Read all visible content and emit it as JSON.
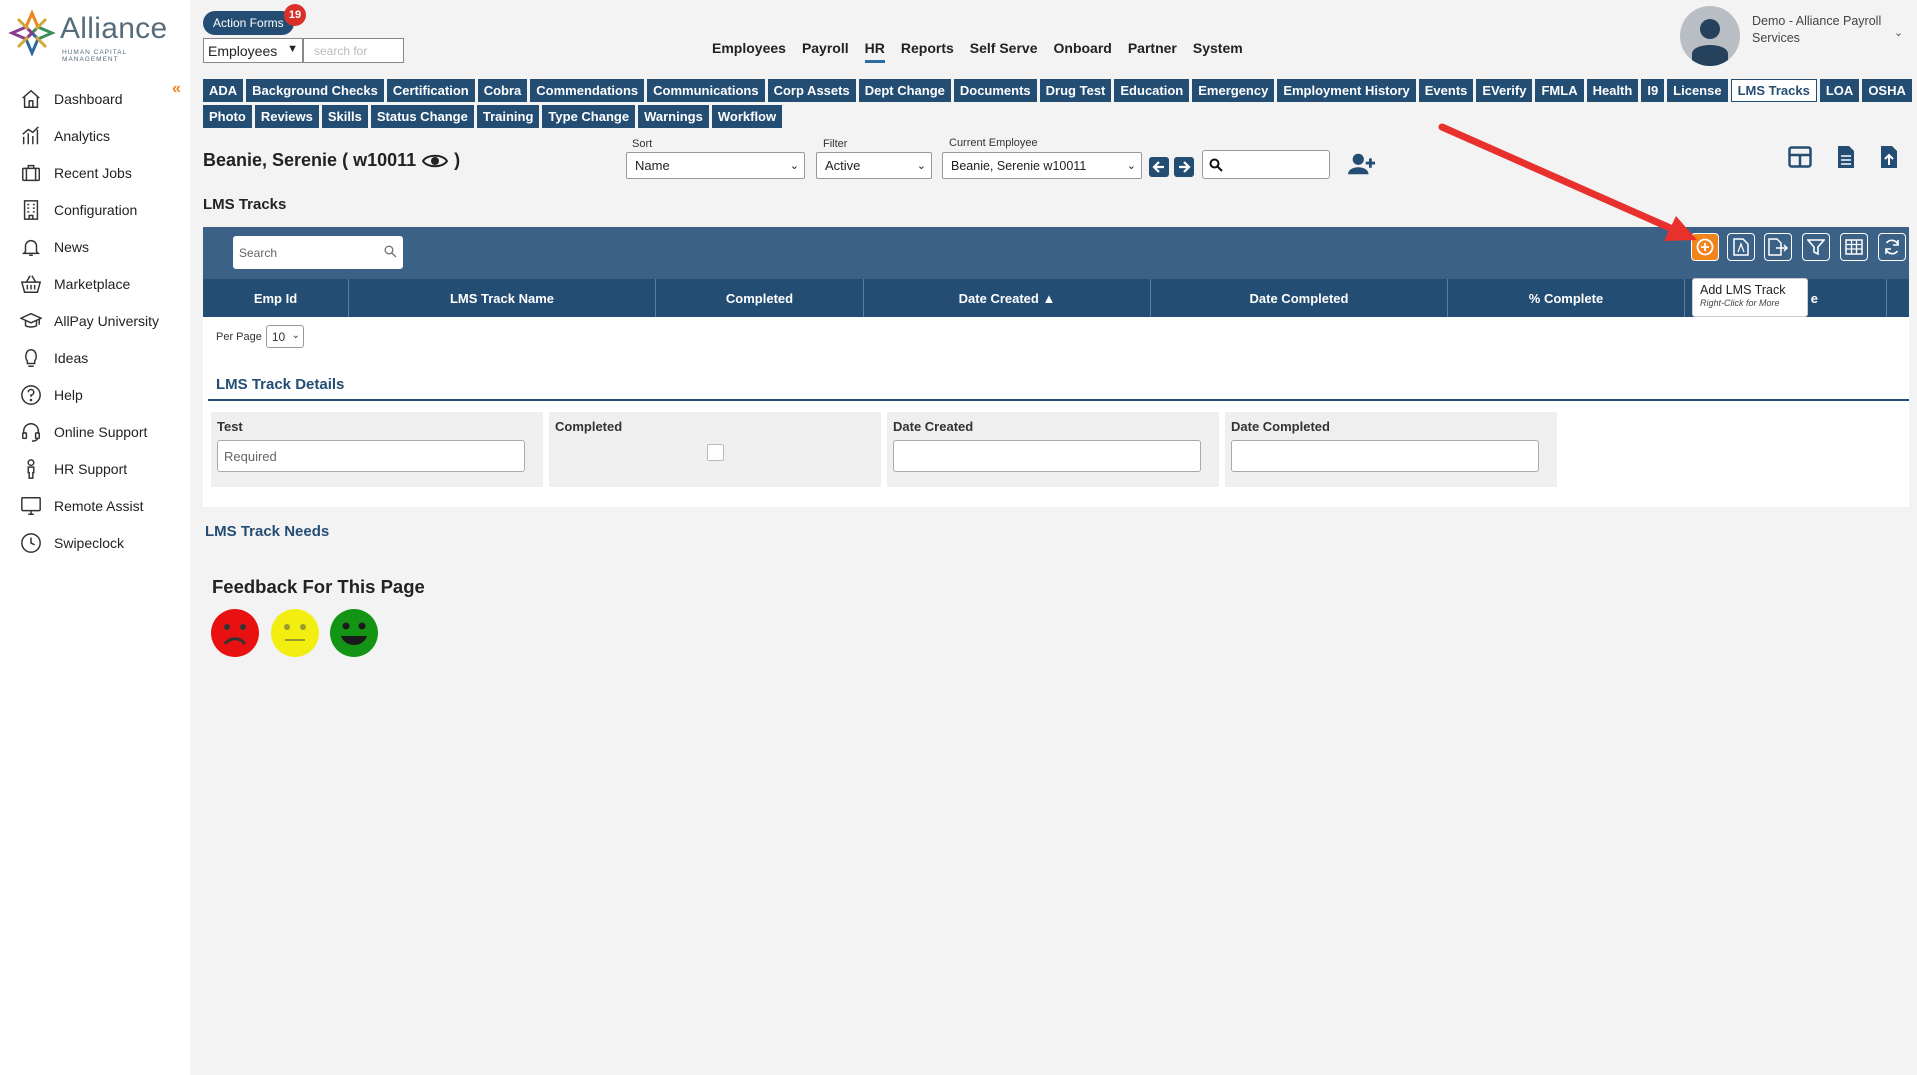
{
  "brand": {
    "name": "Alliance",
    "tagline": "HUMAN CAPITAL MANAGEMENT"
  },
  "sidebar": {
    "collapse_icon": "double-chevron-left-icon",
    "items": [
      {
        "label": "Dashboard",
        "icon": "home-icon"
      },
      {
        "label": "Analytics",
        "icon": "bar-chart-icon"
      },
      {
        "label": "Recent Jobs",
        "icon": "briefcase-icon"
      },
      {
        "label": "Configuration",
        "icon": "building-icon"
      },
      {
        "label": "News",
        "icon": "bell-icon"
      },
      {
        "label": "Marketplace",
        "icon": "basket-icon"
      },
      {
        "label": "AllPay University",
        "icon": "graduation-cap-icon"
      },
      {
        "label": "Ideas",
        "icon": "lightbulb-icon"
      },
      {
        "label": "Help",
        "icon": "question-icon"
      },
      {
        "label": "Online Support",
        "icon": "headset-icon"
      },
      {
        "label": "HR Support",
        "icon": "person-icon"
      },
      {
        "label": "Remote Assist",
        "icon": "monitor-icon"
      },
      {
        "label": "Swipeclock",
        "icon": "clock-icon"
      }
    ]
  },
  "header": {
    "action_forms_label": "Action Forms",
    "action_forms_count": "19",
    "search_type": "Employees",
    "search_placeholder": "search for",
    "nav": [
      "Employees",
      "Payroll",
      "HR",
      "Reports",
      "Self Serve",
      "Onboard",
      "Partner",
      "System"
    ],
    "nav_active": "HR",
    "user_name": "Demo - Alliance Payroll Services"
  },
  "tabs": {
    "items": [
      "ADA",
      "Background Checks",
      "Certification",
      "Cobra",
      "Commendations",
      "Communications",
      "Corp Assets",
      "Dept Change",
      "Documents",
      "Drug Test",
      "Education",
      "Emergency",
      "Employment History",
      "Events",
      "EVerify",
      "FMLA",
      "Health",
      "I9",
      "License",
      "LMS Tracks",
      "LOA",
      "OSHA",
      "Photo",
      "Reviews",
      "Skills",
      "Status Change",
      "Training",
      "Type Change",
      "Warnings",
      "Workflow"
    ],
    "active": "LMS Tracks"
  },
  "employee_bar": {
    "title": "Beanie, Serenie ( w10011",
    "title_close": ")",
    "sort_label": "Sort",
    "sort_value": "Name",
    "filter_label": "Filter",
    "filter_value": "Active",
    "current_label": "Current Employee",
    "current_value": "Beanie, Serenie w10011"
  },
  "page": {
    "section_title": "LMS Tracks",
    "grid_search_placeholder": "Search",
    "columns": [
      "Emp Id",
      "LMS Track Name",
      "Completed",
      "Date Created ▲",
      "Date Completed",
      "% Complete",
      "e"
    ],
    "per_page_label": "Per Page",
    "per_page_value": "10",
    "tooltip_title": "Add LMS Track",
    "tooltip_sub": "Right-Click for More",
    "details_title": "LMS Track Details",
    "details": [
      {
        "label": "Test",
        "placeholder": "Required",
        "kind": "input"
      },
      {
        "label": "Completed",
        "kind": "checkbox"
      },
      {
        "label": "Date Created",
        "placeholder": "",
        "kind": "input"
      },
      {
        "label": "Date Completed",
        "placeholder": "",
        "kind": "input"
      }
    ],
    "needs_title": "LMS Track Needs",
    "feedback_title": "Feedback For This Page"
  },
  "colors": {
    "navy": "#244d74",
    "toolbar": "#3c6186",
    "accent_orange": "#f0841d",
    "annotation_red": "#e8302c",
    "sad": "#e81010",
    "neutral": "#f2ee10",
    "happy": "#149414"
  }
}
